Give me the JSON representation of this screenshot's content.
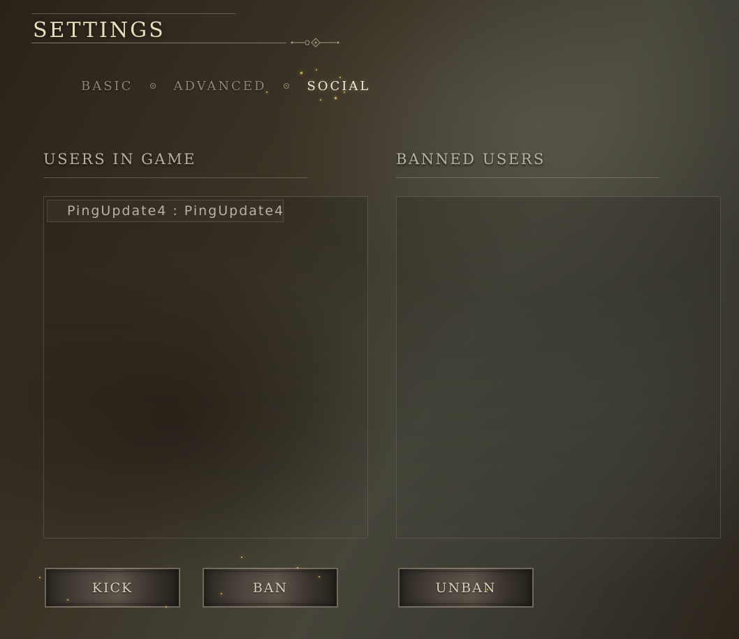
{
  "header": {
    "title": "SETTINGS"
  },
  "tabs": [
    {
      "label": "BASIC",
      "active": false
    },
    {
      "label": "ADVANCED",
      "active": false
    },
    {
      "label": "SOCIAL",
      "active": true
    }
  ],
  "users_in_game": {
    "heading": "USERS IN GAME",
    "items": [
      {
        "label": "PingUpdate4 : PingUpdate4"
      }
    ]
  },
  "banned_users": {
    "heading": "BANNED USERS",
    "items": []
  },
  "buttons": {
    "kick": "KICK",
    "ban": "BAN",
    "unban": "UNBAN"
  },
  "colors": {
    "title": "#e9dfbd",
    "active_tab": "#f1ead8",
    "inactive_tab": "#8f8676",
    "user_marker": "#8a2a2a",
    "spark": "#e2b94a"
  },
  "icons": {
    "tab_separator": "small-circle-icon",
    "title_ornament": "diamond-ornament-icon",
    "user_marker": "player-marker-icon"
  }
}
